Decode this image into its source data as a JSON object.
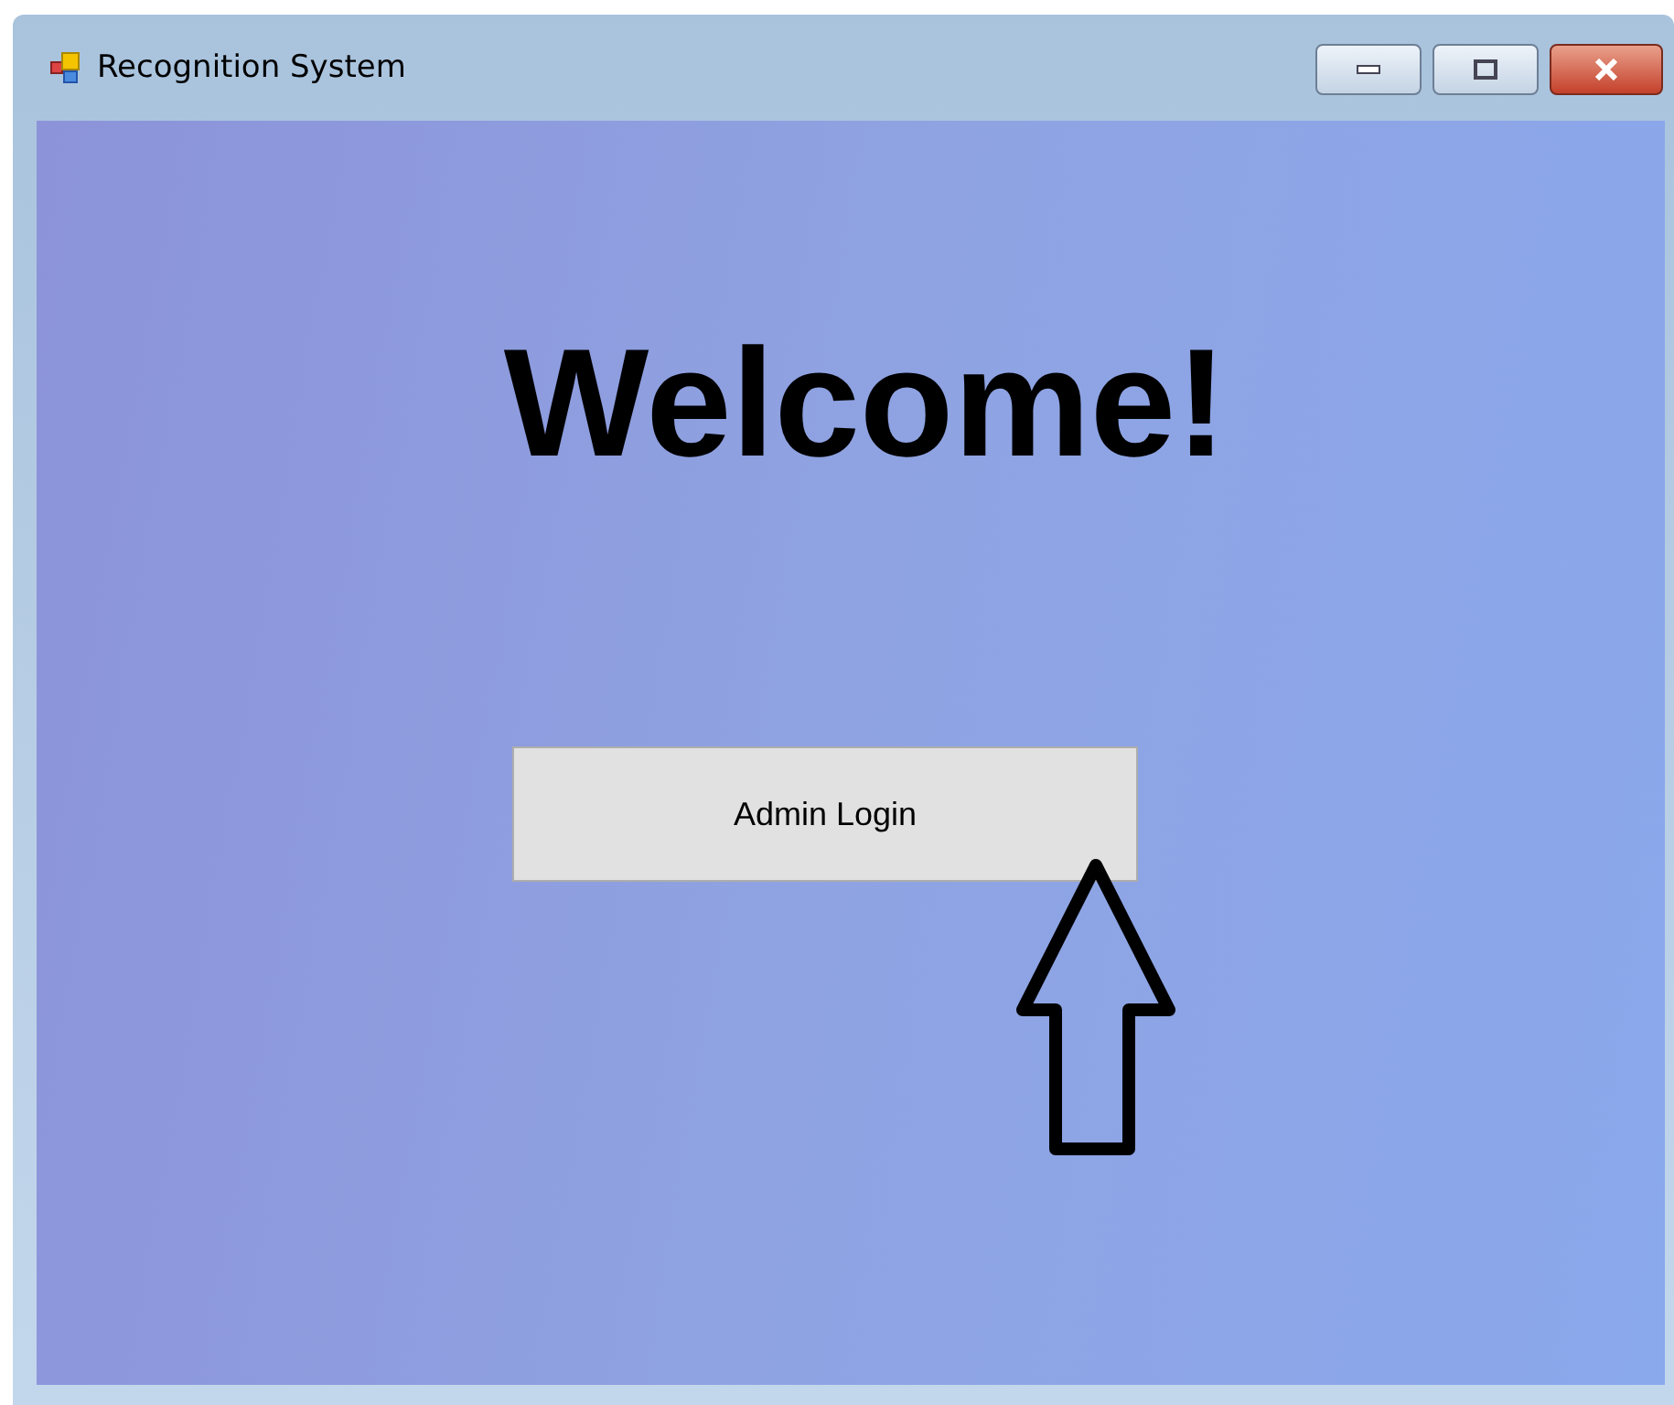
{
  "window": {
    "title": "Recognition System"
  },
  "heading": "Welcome!",
  "buttons": [
    {
      "label": "Admin Login"
    }
  ]
}
